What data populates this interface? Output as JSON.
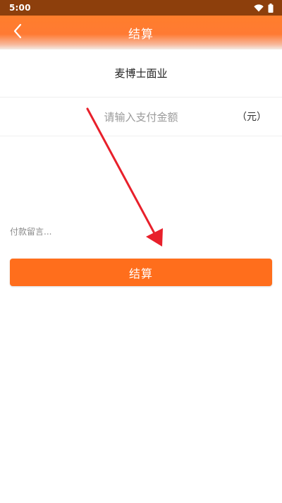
{
  "status_bar": {
    "time": "5:00",
    "icons": [
      "wifi-icon",
      "battery-icon"
    ]
  },
  "header": {
    "back_icon": "chevron-left-icon",
    "title": "结算"
  },
  "merchant": {
    "name": "麦博士面业"
  },
  "amount": {
    "value": "",
    "placeholder": "请输入支付金额",
    "unit": "（元）"
  },
  "remark": {
    "value": "",
    "placeholder": "付款留言..."
  },
  "checkout": {
    "label": "结算"
  },
  "colors": {
    "status_bar": "#8d3f0c",
    "header_accent": "#ff7e2c",
    "button": "#ff6e1c",
    "annotation_arrow": "#e8202b"
  }
}
